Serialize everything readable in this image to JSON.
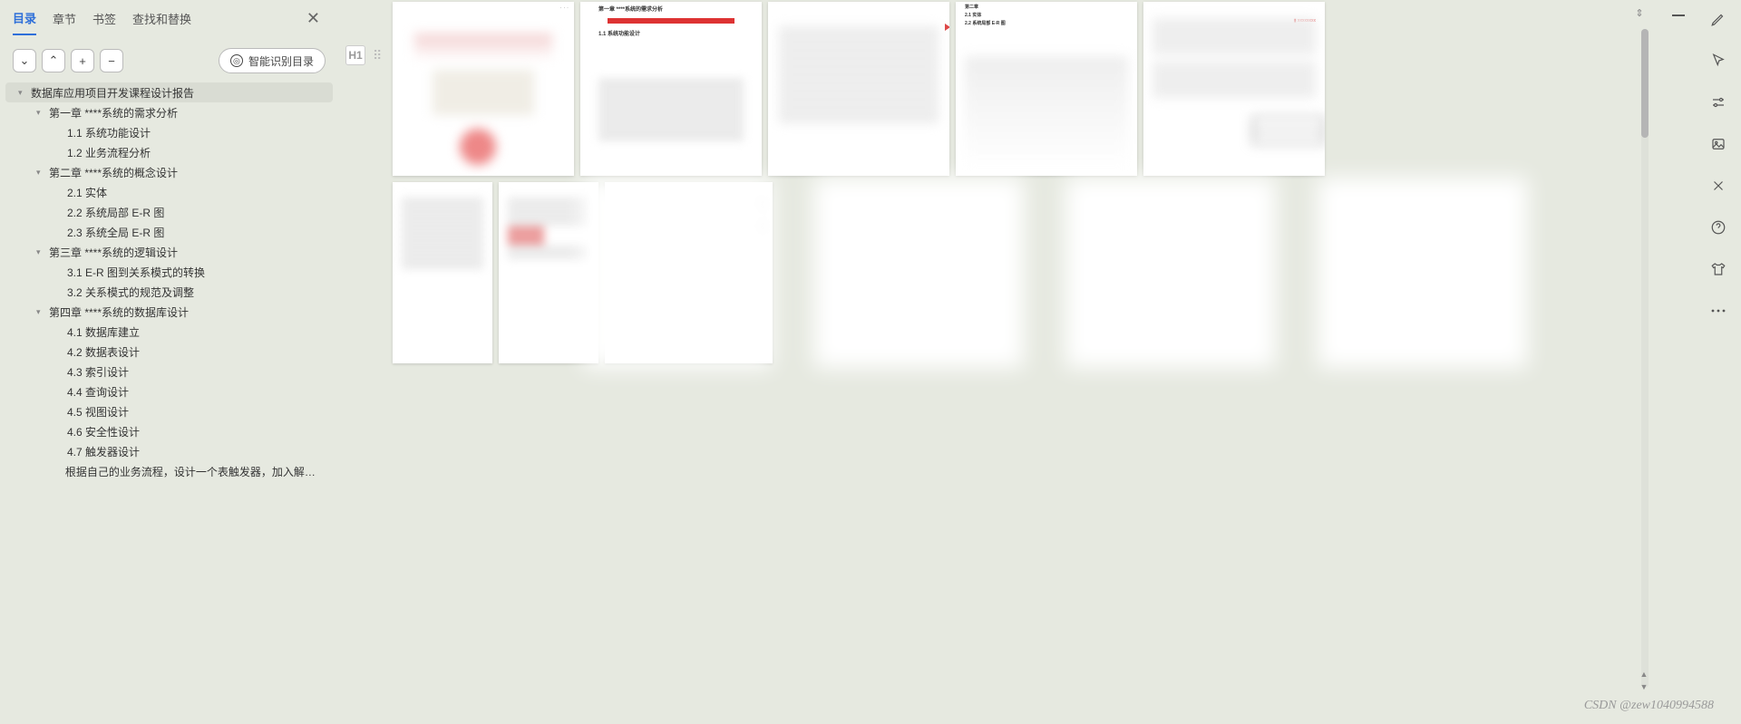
{
  "tabs": {
    "toc": "目录",
    "chapter": "章节",
    "bookmark": "书签",
    "find": "查找和替换"
  },
  "toolbar": {
    "expand": "⌄",
    "collapse": "⌃",
    "add": "+",
    "remove": "−",
    "smart": "智能识别目录",
    "h1": "H1"
  },
  "tree": [
    {
      "lvl": 0,
      "caret": "▾",
      "label": "数据库应用项目开发课程设计报告",
      "root": true
    },
    {
      "lvl": 1,
      "caret": "▾",
      "label": "第一章    ****系统的需求分析"
    },
    {
      "lvl": 2,
      "caret": "",
      "label": "1.1 系统功能设计"
    },
    {
      "lvl": 2,
      "caret": "",
      "label": "1.2 业务流程分析"
    },
    {
      "lvl": 1,
      "caret": "▾",
      "label": "第二章    ****系统的概念设计"
    },
    {
      "lvl": 2,
      "caret": "",
      "label": "2.1   实体"
    },
    {
      "lvl": 2,
      "caret": "",
      "label": "2.2 系统局部 E-R 图"
    },
    {
      "lvl": 2,
      "caret": "",
      "label": "2.3 系统全局 E-R 图"
    },
    {
      "lvl": 1,
      "caret": "▾",
      "label": "第三章    ****系统的逻辑设计"
    },
    {
      "lvl": 2,
      "caret": "",
      "label": "3.1    E-R 图到关系模式的转换"
    },
    {
      "lvl": 2,
      "caret": "",
      "label": "3.2    关系模式的规范及调整"
    },
    {
      "lvl": 1,
      "caret": "▾",
      "label": "第四章    ****系统的数据库设计"
    },
    {
      "lvl": 2,
      "caret": "",
      "label": "4.1 数据库建立"
    },
    {
      "lvl": 2,
      "caret": "",
      "label": "4.2 数据表设计"
    },
    {
      "lvl": 2,
      "caret": "",
      "label": "4.3 索引设计"
    },
    {
      "lvl": 2,
      "caret": "",
      "label": "4.4 查询设计"
    },
    {
      "lvl": 2,
      "caret": "",
      "label": "4.5 视图设计"
    },
    {
      "lvl": 2,
      "caret": "",
      "label": "4.6 安全性设计"
    },
    {
      "lvl": 2,
      "caret": "",
      "label": "4.7 触发器设计"
    },
    {
      "lvl": 3,
      "caret": "",
      "label": "根据自己的业务流程，设计一个表触发器，加入解释说明该触发器 ..."
    }
  ],
  "pg2": {
    "t1": "第一章    ****系统的需求分析",
    "t2": "1.1 系统功能设计"
  },
  "pg4": {
    "a": "第二章",
    "b": "2.1 实体",
    "c": "2.2 系统局部 E-R 图"
  },
  "watermark": "CSDN @zew1040994588"
}
